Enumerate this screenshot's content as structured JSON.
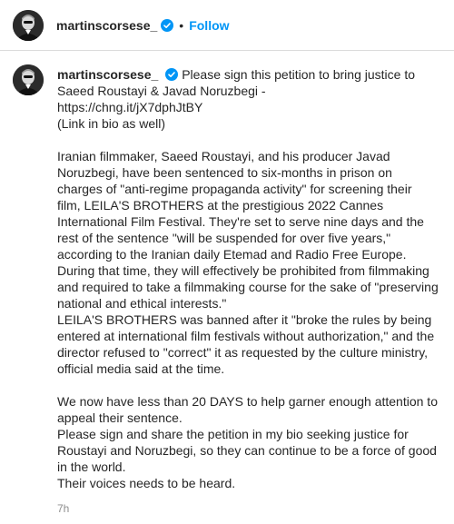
{
  "header": {
    "username": "martinscorsese_",
    "separator": "•",
    "follow_label": "Follow",
    "verified_icon": "verified-badge-icon"
  },
  "post": {
    "username": "martinscorsese_",
    "verified_icon": "verified-badge-icon",
    "caption_lines": [
      "Please sign this petition to bring justice to Saeed Roustayi & Javad Noruzbegi -",
      "https://chng.it/jX7dphJtBY",
      "(Link in bio as well)",
      "",
      "Iranian filmmaker, Saeed Roustayi, and his producer Javad Noruzbegi, have been sentenced to six-months in prison on charges of \"anti-regime propaganda activity\" for screening their film, LEILA'S BROTHERS at the prestigious 2022 Cannes International Film Festival. They're set to serve nine days and the rest of the sentence \"will be suspended for over five years,\" according to the Iranian daily Etemad and Radio Free Europe. During that time, they will effectively be prohibited from filmmaking and required to take a filmmaking course for the sake of \"preserving national and ethical interests.\"",
      "LEILA'S BROTHERS was banned after it \"broke the rules by being entered at international film festivals without authorization,\" and the director refused to \"correct\" it as requested by the culture ministry, official media said at the time.",
      "",
      "We now have less than 20 DAYS to help garner enough attention to appeal their sentence.",
      "Please sign and share the petition in my bio seeking justice for Roustayi and Noruzbegi, so they can continue to be a force of good in the world.",
      "Their voices needs to be heard."
    ],
    "timestamp": "7h"
  },
  "colors": {
    "accent": "#0095f6",
    "text": "#262626",
    "muted": "#8e8e8e",
    "border": "#dbdbdb"
  }
}
